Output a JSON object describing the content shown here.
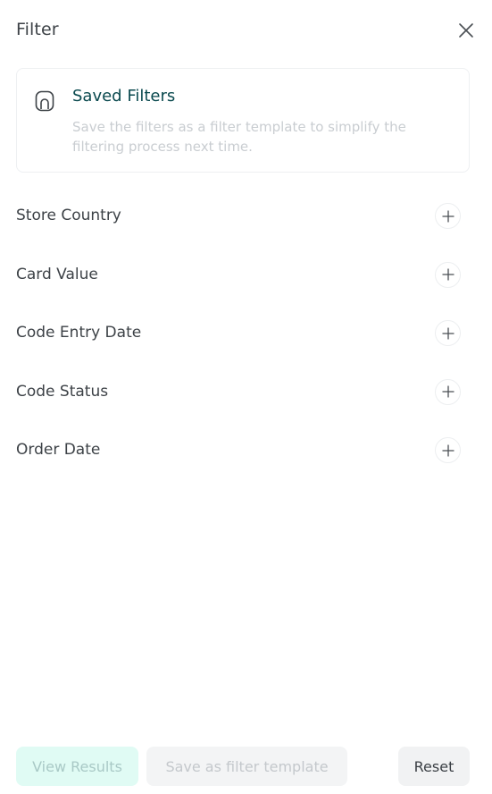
{
  "header": {
    "title": "Filter"
  },
  "saved_filters": {
    "title": "Saved Filters",
    "description": "Save the filters as a filter template to simplify the filtering process next time."
  },
  "filters": [
    {
      "label": "Store Country"
    },
    {
      "label": "Card Value"
    },
    {
      "label": "Code Entry Date"
    },
    {
      "label": "Code Status"
    },
    {
      "label": "Order Date"
    }
  ],
  "footer": {
    "view_results_label": "View Results",
    "save_template_label": "Save as filter template",
    "reset_label": "Reset"
  },
  "colors": {
    "accent_title": "#0b4a4f",
    "view_results_bg": "#e0fbf4",
    "muted_text": "#c9cdd1"
  },
  "icons": {
    "close": "close-icon",
    "saved": "bookmark-icon",
    "add": "plus-icon"
  }
}
